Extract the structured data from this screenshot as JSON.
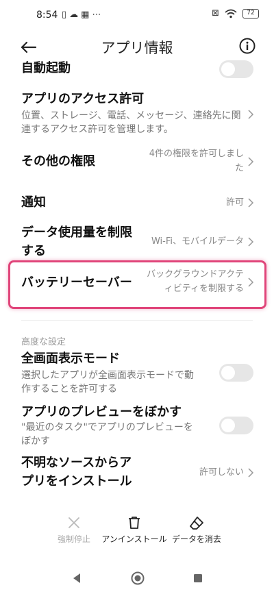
{
  "status_bar": {
    "time": "8:54",
    "left_icons": [
      "phone-icon",
      "cloud-icon",
      "grid-icon",
      "more-icon"
    ],
    "battery": "72"
  },
  "header": {
    "title": "アプリ情報"
  },
  "rows": {
    "auto_start": {
      "title": "自動起動"
    },
    "access_permissions": {
      "title": "アプリのアクセス許可",
      "desc_line1": "位置、ストレージ、電話、メッセージ、連絡先に関",
      "desc_line2": "連するアクセス許可を管理します。"
    },
    "other_permissions": {
      "title": "その他の権限",
      "value_line1": "4件の権限を許可しまし",
      "value_line2": "た"
    },
    "notifications": {
      "title": "通知",
      "value": "許可"
    },
    "data_usage": {
      "title_line1": "データ使用量を制限",
      "title_line2": "する",
      "value": "Wi-Fi、モバイルデータ"
    },
    "battery_saver": {
      "title": "バッテリーセーバー",
      "value_line1": "バックグラウンドアクテ",
      "value_line2": "ィビティを制限する"
    }
  },
  "advanced": {
    "section_label": "高度な設定",
    "fullscreen": {
      "title": "全画面表示モード",
      "desc_line1": "選択したアプリが全画面表示モードで動",
      "desc_line2": "作することを許可する"
    },
    "blur_preview": {
      "title": "アプリのプレビューをぼかす",
      "desc_line1": "\"最近のタスク\"でアプリのプレビューを",
      "desc_line2": "ぼかす"
    },
    "unknown_sources": {
      "title_line1": "不明なソースからア",
      "title_line2": "プリをインストール",
      "value": "許可しない"
    }
  },
  "actions": {
    "force_stop": "強制停止",
    "uninstall": "アンインストール",
    "clear_data": "データを消去"
  },
  "colors": {
    "highlight": "#e0457a",
    "toggle_off": "#e6e6e6"
  }
}
